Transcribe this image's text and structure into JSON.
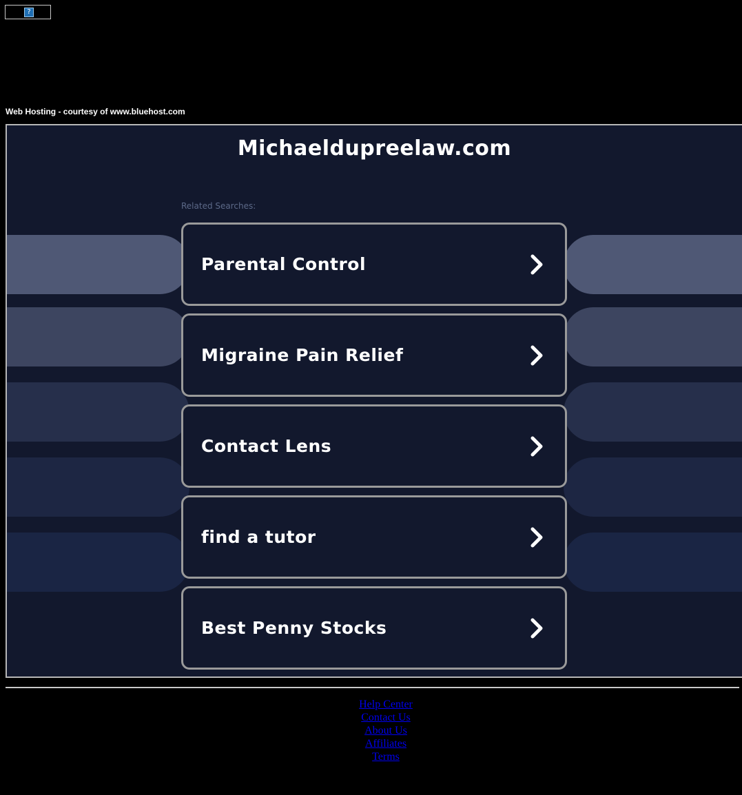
{
  "top_image": {
    "glyph": "?"
  },
  "hosting_note": "Web Hosting - courtesy of www.bluehost.com",
  "site_title": "Michaeldupreelaw.com",
  "related_label": "Related Searches:",
  "searches": [
    {
      "label": "Parental Control",
      "icon": "chevron-right-icon"
    },
    {
      "label": "Migraine Pain Relief",
      "icon": "chevron-right-icon"
    },
    {
      "label": "Contact Lens",
      "icon": "chevron-right-icon"
    },
    {
      "label": "find a tutor",
      "icon": "chevron-right-icon"
    },
    {
      "label": "Best Penny Stocks",
      "icon": "chevron-right-icon"
    }
  ],
  "footer": {
    "links": [
      "Help Center",
      "Contact Us",
      "About Us",
      "Affiliates",
      "Terms"
    ]
  },
  "colors": {
    "background": "#000000",
    "frame_background": "#12182d",
    "card_border": "#9a9a9a",
    "related_label": "#5c6988",
    "footer_link": "#0000ee",
    "side_pills": [
      "#4f5875",
      "#3d4560",
      "#262f4b",
      "#1d2643",
      "#1a2544"
    ]
  }
}
